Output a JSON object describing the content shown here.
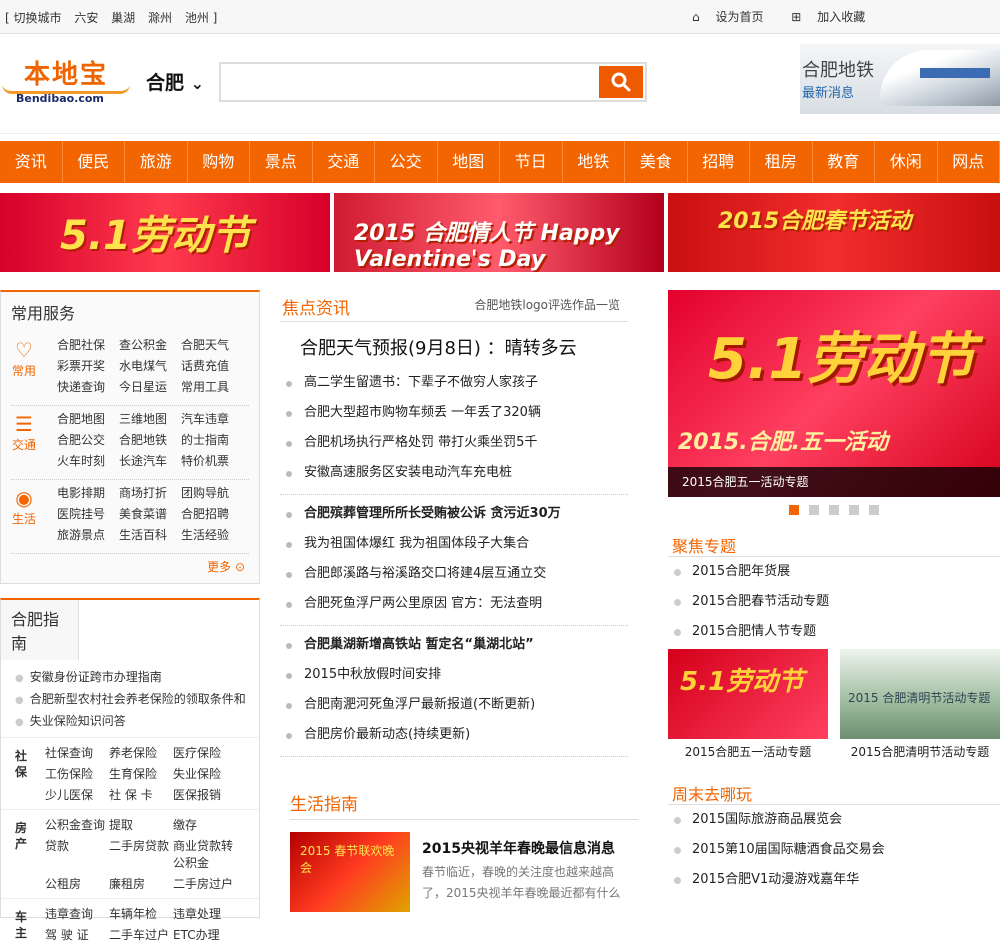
{
  "topbar": {
    "cities_label": "[ 切换城市",
    "cities": [
      "六安",
      "巢湖",
      "滁州",
      "池州 ]"
    ],
    "set_home": "设为首页",
    "add_fav": "加入收藏"
  },
  "header": {
    "logo_cn": "本地宝",
    "logo_en": "Bendibao.com",
    "city": "合肥",
    "search_placeholder": "",
    "ad_title": "合肥地铁",
    "ad_sub": "最新消息"
  },
  "nav": [
    "资讯",
    "便民",
    "旅游",
    "购物",
    "景点",
    "交通",
    "公交",
    "地图",
    "节日",
    "地铁",
    "美食",
    "招聘",
    "租房",
    "教育",
    "休闲",
    "网点"
  ],
  "banners": [
    {
      "text": "5.1劳动节"
    },
    {
      "text": "2015 合肥情人节  Happy Valentine's Day"
    },
    {
      "text": "2015合肥春节活动"
    }
  ],
  "services": {
    "title": "常用服务",
    "groups": [
      {
        "label": "常用",
        "icon": "heart-icon",
        "items": [
          "合肥社保",
          "查公积金",
          "合肥天气",
          "彩票开奖",
          "水电煤气",
          "话费充值",
          "快递查询",
          "今日星运",
          "常用工具"
        ]
      },
      {
        "label": "交通",
        "icon": "traffic-light-icon",
        "items": [
          "合肥地图",
          "三维地图",
          "汽车违章",
          "合肥公交",
          "合肥地铁",
          "的士指南",
          "火车时刻",
          "长途汽车",
          "特价机票"
        ]
      },
      {
        "label": "生活",
        "icon": "life-icon",
        "items": [
          "电影排期",
          "商场打折",
          "团购导航",
          "医院挂号",
          "美食菜谱",
          "合肥招聘",
          "旅游景点",
          "生活百科",
          "生活经验"
        ]
      }
    ],
    "more": "更多"
  },
  "guide": {
    "title": "合肥指南",
    "links": [
      "安徽身份证跨市办理指南",
      "合肥新型农村社会养老保险的领取条件和",
      "失业保险知识问答"
    ],
    "sections": [
      {
        "label": "社保",
        "items": [
          "社保查询",
          "养老保险",
          "医疗保险",
          "工伤保险",
          "生育保险",
          "失业保险",
          "少儿医保",
          "社 保 卡",
          "医保报销"
        ]
      },
      {
        "label": "房产",
        "items": [
          "公积金查询",
          "提取",
          "缴存",
          "贷款",
          "二手房贷款",
          "商业贷款转公积金",
          "公租房",
          "廉租房",
          "二手房过户"
        ]
      },
      {
        "label": "车主",
        "items": [
          "违章查询",
          "车辆年检",
          "违章处理",
          "驾 驶 证",
          "二手车过户",
          "ETC办理"
        ]
      }
    ]
  },
  "focus": {
    "title": "焦点资讯",
    "right_link": "合肥地铁logo评选作品一览",
    "headline": "合肥天气预报(9月8日) ：晴转多云",
    "groups": [
      {
        "items": [
          {
            "t": "高二学生留遗书：下辈子不做穷人家孩子",
            "b": false
          },
          {
            "t": "合肥大型超市购物车频丢 一年丢了320辆",
            "b": false
          },
          {
            "t": "合肥机场执行严格处罚 带打火乘坐罚5千",
            "b": false
          },
          {
            "t": "安徽高速服务区安装电动汽车充电桩",
            "b": false
          }
        ]
      },
      {
        "items": [
          {
            "t": "合肥殡葬管理所所长受贿被公诉 贪污近30万",
            "b": true
          },
          {
            "t": "我为祖国体爆红 我为祖国体段子大集合",
            "b": false
          },
          {
            "t": "合肥郎溪路与裕溪路交口将建4层互通立交",
            "b": false
          },
          {
            "t": "合肥死鱼浮尸两公里原因 官方：无法查明",
            "b": false
          }
        ]
      },
      {
        "items": [
          {
            "t": "合肥巢湖新增高铁站 暂定名“巢湖北站”",
            "b": true
          },
          {
            "t": "2015中秋放假时间安排",
            "b": false
          },
          {
            "t": "合肥南淝河死鱼浮尸最新报道(不断更新)",
            "b": false
          },
          {
            "t": "合肥房价最新动态(持续更新)",
            "b": false
          }
        ]
      }
    ]
  },
  "life": {
    "title": "生活指南",
    "img_text": "2015 春节联欢晚会",
    "article_title": "2015央视羊年春晚最信息消息",
    "article_desc": "春节临近，春晚的关注度也越来越高了，2015央视羊年春晚最近都有什么"
  },
  "slide": {
    "big": "5.1劳动节",
    "sub": "2015.合肥.五一活动",
    "caption": "2015合肥五一活动专题",
    "dots": 5,
    "active": 0
  },
  "topics": {
    "title": "聚焦专题",
    "items": [
      "2015合肥年货展",
      "2015合肥春节活动专题",
      "2015合肥情人节专题"
    ],
    "thumbs": [
      {
        "img": "5.1劳动节",
        "caption": "2015合肥五一活动专题"
      },
      {
        "img": "2015 合肥清明节活动专题",
        "caption": "2015合肥清明节活动专题"
      }
    ]
  },
  "weekend": {
    "title": "周末去哪玩",
    "items": [
      "2015国际旅游商品展览会",
      "2015第10届国际糖酒食品交易会",
      "2015合肥V1动漫游戏嘉年华"
    ]
  },
  "colors": {
    "accent": "#f26500",
    "brand_blue": "#1a2c6b"
  }
}
